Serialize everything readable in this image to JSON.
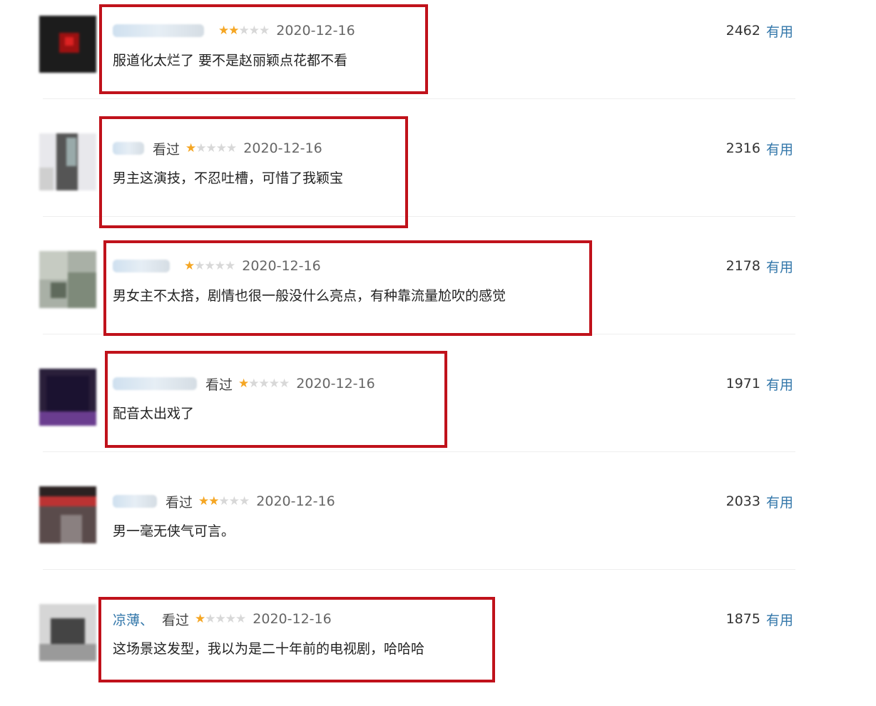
{
  "comments": [
    {
      "user": "",
      "status": "",
      "rating": 2,
      "date": "2020-12-16",
      "text": "服道化太烂了 要不是赵丽颖点花都不看",
      "votes": "2462",
      "useful_label": "有用"
    },
    {
      "user": "",
      "status": "看过",
      "rating": 1,
      "date": "2020-12-16",
      "text": "男主这演技，不忍吐槽，可惜了我颖宝",
      "votes": "2316",
      "useful_label": "有用"
    },
    {
      "user": "",
      "status": "",
      "rating": 1,
      "date": "2020-12-16",
      "text": "男女主不太搭，剧情也很一般没什么亮点，有种靠流量尬吹的感觉",
      "votes": "2178",
      "useful_label": "有用"
    },
    {
      "user": "",
      "status": "看过",
      "rating": 1,
      "date": "2020-12-16",
      "text": "配音太出戏了",
      "votes": "1971",
      "useful_label": "有用"
    },
    {
      "user": "",
      "status": "看过",
      "rating": 2,
      "date": "2020-12-16",
      "text": "男一毫无侠气可言。",
      "votes": "2033",
      "useful_label": "有用"
    },
    {
      "user": "凉薄、",
      "status": "看过",
      "rating": 1,
      "date": "2020-12-16",
      "text": "这场景这发型，我以为是二十年前的电视剧，哈哈哈",
      "votes": "1875",
      "useful_label": "有用"
    }
  ],
  "colors": {
    "link": "#3377aa",
    "star_on": "#f5a623",
    "star_off": "#d8d8d8",
    "highlight_box": "#c0121b"
  }
}
